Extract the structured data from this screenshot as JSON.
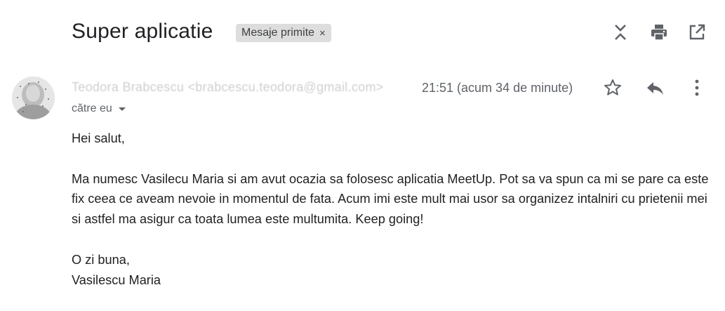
{
  "email": {
    "subject": "Super aplicatie",
    "label": {
      "text": "Mesaje primite",
      "remove_glyph": "×"
    },
    "sender": "Teodora Brabcescu <brabcescu.teodora@gmail.com>",
    "timestamp": "21:51 (acum 34 de minute)",
    "recipient": "către eu",
    "body": {
      "greeting": "Hei salut,",
      "paragraph": "Ma numesc Vasilecu Maria si am avut ocazia sa folosesc aplicatia MeetUp. Pot sa va spun ca mi se pare ca este fix ceea ce aveam nevoie in momentul de fata. Acum imi este mult mai usor sa organizez intalniri cu prietenii mei si astfel ma asigur ca toata lumea este multumita. Keep going!",
      "closing": "O zi buna,",
      "signature": "Vasilescu Maria"
    }
  },
  "icons": {
    "toolbar": [
      "collapse-all-icon",
      "print-icon",
      "open-in-new-window-icon"
    ],
    "message": [
      "star-icon",
      "reply-icon",
      "more-vert-icon"
    ]
  },
  "colors": {
    "text": "#202124",
    "secondary_text": "#5f6368",
    "chip_background": "#dddddd",
    "icon": "#5f6368"
  }
}
